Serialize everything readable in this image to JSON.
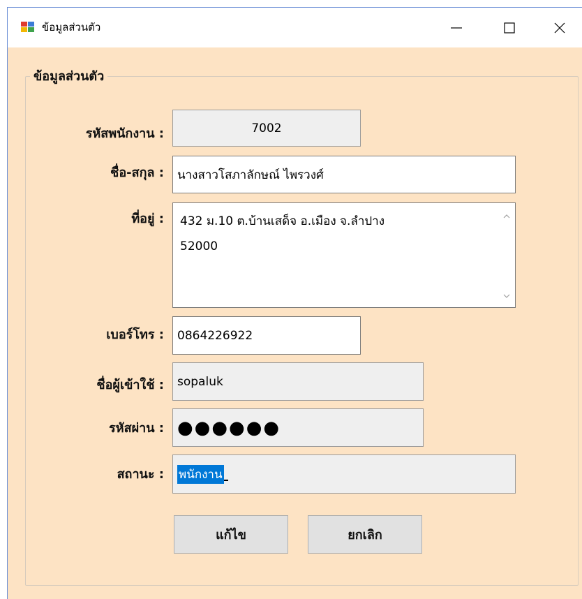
{
  "window": {
    "title": "ข้อมูลส่วนตัว"
  },
  "group": {
    "legend": "ข้อมูลส่วนตัว"
  },
  "form": {
    "employee_id_label": "รหัสพนักงาน :",
    "employee_id_value": "7002",
    "fullname_label": "ชื่อ-สกุล :",
    "fullname_value": "นางสาวโสภาลักษณ์ ไพรวงศ์",
    "address_label": "ที่อยู่ :",
    "address_value": "432 ม.10 ต.บ้านเสด็จ อ.เมือง จ.ลำปาง\n52000",
    "phone_label": "เบอร์โทร :",
    "phone_value": "0864226922",
    "username_label": "ชื่อผู้เข้าใช้ :",
    "username_value": "sopaluk",
    "password_label": "รหัสผ่าน :",
    "password_value": "●●●●●●",
    "status_label": "สถานะ :",
    "status_value": "พนักงาน"
  },
  "buttons": {
    "edit_label": "แก้ไข",
    "cancel_label": "ยกเลิก"
  },
  "colors": {
    "form_background": "#fde3c4",
    "selection": "#0078d7",
    "readonly_field": "#efefef"
  }
}
